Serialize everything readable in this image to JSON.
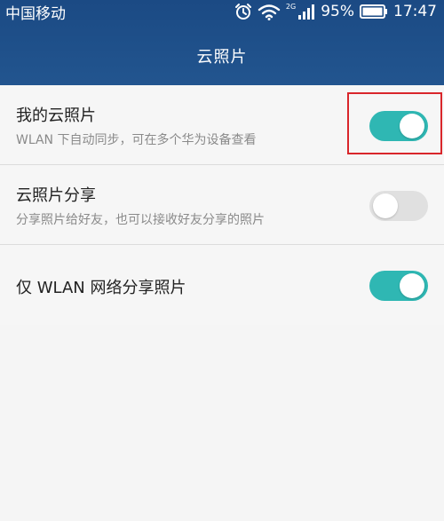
{
  "status_bar": {
    "carrier": "中国移动",
    "network_label": "2G",
    "battery_percent": "95%",
    "time": "17:47",
    "icons": [
      "alarm-icon",
      "wifi-icon",
      "signal-icon",
      "battery-icon"
    ]
  },
  "header": {
    "title": "云照片"
  },
  "settings": [
    {
      "title": "我的云照片",
      "subtitle": "WLAN 下自动同步，可在多个华为设备查看",
      "enabled": true
    },
    {
      "title": "云照片分享",
      "subtitle": "分享照片给好友，也可以接收好友分享的照片",
      "enabled": false
    },
    {
      "title": "仅 WLAN 网络分享照片",
      "enabled": true
    }
  ],
  "colors": {
    "header": "#1f4f8a",
    "toggle_on": "#2fb7b3",
    "toggle_off": "#e0e0e0",
    "highlight": "#d9262b"
  }
}
